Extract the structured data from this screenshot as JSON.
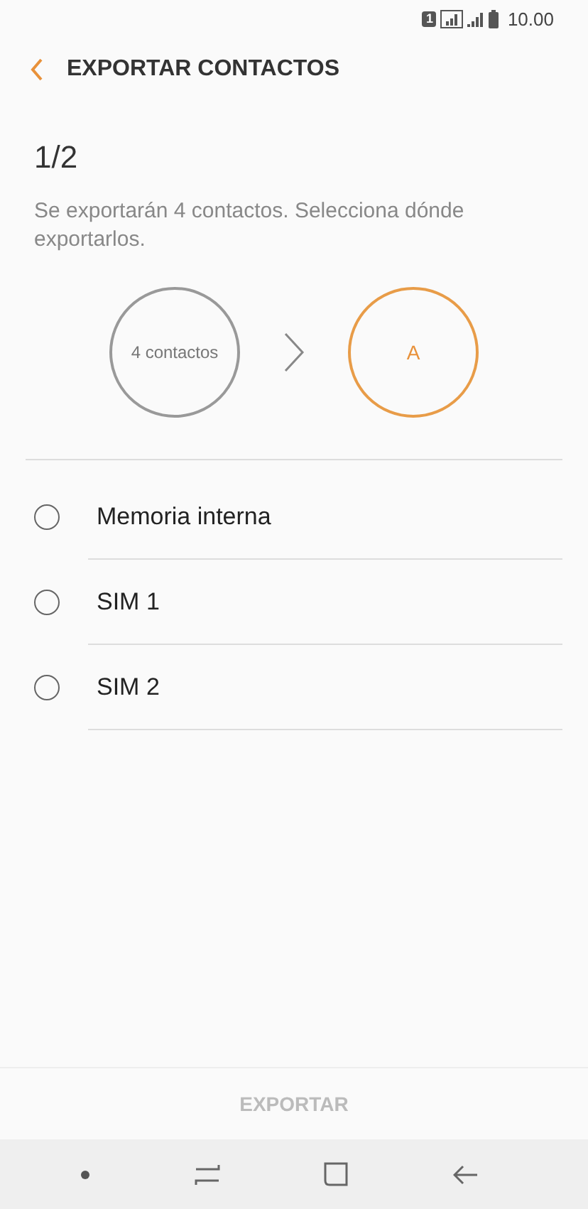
{
  "status_bar": {
    "sim_badge": "1",
    "time": "10.00"
  },
  "header": {
    "title": "EXPORTAR CONTACTOS"
  },
  "step": "1/2",
  "description": "Se exportarán 4 contactos. Selecciona dónde exportarlos.",
  "flow": {
    "source": "4 contactos",
    "target": "A"
  },
  "options": [
    {
      "label": "Memoria interna",
      "selected": false
    },
    {
      "label": "SIM 1",
      "selected": false
    },
    {
      "label": "SIM 2",
      "selected": false
    }
  ],
  "export_button": {
    "label": "EXPORTAR",
    "disabled": true
  }
}
